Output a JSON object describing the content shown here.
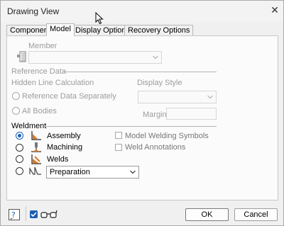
{
  "window": {
    "title": "Drawing View"
  },
  "tabs": [
    {
      "label": "Component"
    },
    {
      "label": "Model"
    },
    {
      "label": "Display Options"
    },
    {
      "label": "Recovery Options"
    }
  ],
  "model": {
    "member": {
      "label": "Member",
      "value": ""
    },
    "reference_data": {
      "section_label": "Reference Data",
      "hidden_line_label": "Hidden Line Calculation",
      "display_style_label": "Display Style",
      "radio_separately": "Reference Data Separately",
      "radio_all_bodies": "All Bodies",
      "margin_label": "Margin",
      "margin_value": ""
    },
    "weldment": {
      "section_label": "Weldment",
      "options": [
        {
          "label": "Assembly",
          "selected": true
        },
        {
          "label": "Machining",
          "selected": false
        },
        {
          "label": "Welds",
          "selected": false
        }
      ],
      "preparation_value": "Preparation",
      "model_welding_symbols": "Model Welding Symbols",
      "weld_annotations": "Weld Annotations"
    }
  },
  "footer": {
    "ok_label": "OK",
    "cancel_label": "Cancel"
  },
  "colors": {
    "accent": "#1a5fb4",
    "weld_icon_orange": "#e07a1f"
  }
}
